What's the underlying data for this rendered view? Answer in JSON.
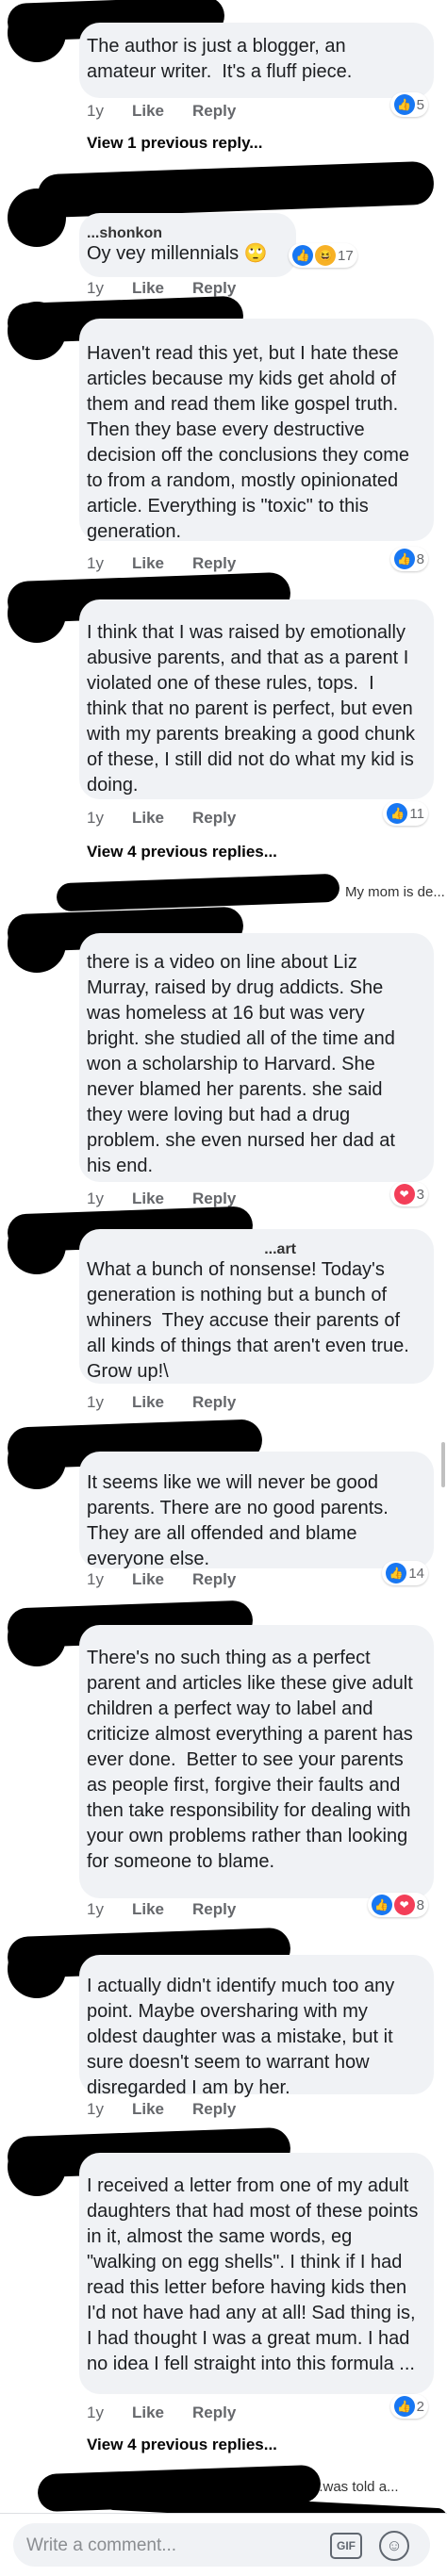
{
  "comments": [
    {
      "author": "",
      "text": "The author is just a blogger, an amateur writer.  It's a fluff piece.",
      "time": "1y",
      "like": "Like",
      "reply": "Reply",
      "reactions": "5",
      "view_replies": "View 1 previous reply..."
    },
    {
      "author": "...shonkon",
      "text": "Oy vey millennials 🙄",
      "time": "1y",
      "like": "Like",
      "reply": "Reply",
      "reactions": "17"
    },
    {
      "author": "",
      "text": "Haven't read this yet, but I hate these articles because my kids get ahold of them and read them like gospel truth. Then they base every destructive decision off the conclusions they come to from a random, mostly opinionated article. Everything is \"toxic\" to this generation.",
      "time": "1y",
      "like": "Like",
      "reply": "Reply",
      "reactions": "8"
    },
    {
      "author": "",
      "text": "I think that I was raised by emotionally abusive parents, and that as a parent I violated one of these rules, tops.  I think that no parent is perfect, but even with my parents breaking a good chunk of these, I still did not do what my kid is doing.",
      "time": "1y",
      "like": "Like",
      "reply": "Reply",
      "reactions": "11",
      "view_replies": "View 4 previous replies..."
    },
    {
      "author": "",
      "text": "there is a video on line about Liz Murray, raised by drug addicts. She was homeless at 16 but was very bright. she studied all of the time and won a scholarship to Harvard. She never blamed her parents. she said they were loving but had a drug problem. she even nursed her dad at his end.",
      "time": "1y",
      "like": "Like",
      "reply": "Reply",
      "reactions": "3"
    },
    {
      "author": "...art",
      "text": "What a bunch of nonsense! Today's generation is nothing but a bunch of whiners  They accuse their parents of all kinds of things that aren't even true. Grow up!\\",
      "time": "1y",
      "like": "Like",
      "reply": "Reply",
      "reactions": ""
    },
    {
      "author": "",
      "text": "It seems like we will never be good parents. There are no good parents. They are all offended and blame everyone else.",
      "time": "1y",
      "like": "Like",
      "reply": "Reply",
      "reactions": "14"
    },
    {
      "author": "",
      "text": "There's no such thing as a perfect parent and articles like these give adult children a perfect way to label and criticize almost everything a parent has ever done.  Better to see your parents as people first, forgive their faults and then take responsibility for dealing with your own problems rather than looking for someone to blame.",
      "time": "1y",
      "like": "Like",
      "reply": "Reply",
      "reactions": "8"
    },
    {
      "author": "",
      "text": "I actually didn't identify much too any point. Maybe oversharing with my oldest daughter was a mistake, but it sure doesn't seem to warrant how disregarded I am by her.",
      "time": "1y",
      "like": "Like",
      "reply": "Reply",
      "reactions": ""
    },
    {
      "author": "",
      "text": "I received a letter from one of my adult daughters that had most of these points in it, almost the same words, eg \"walking on egg shells\". I think if I had read this letter before having kids then I'd not have had any at all! Sad thing is, I had thought I was a great mum. I had no idea I fell straight into this formula ...",
      "time": "1y",
      "like": "Like",
      "reply": "Reply",
      "reactions": "2",
      "view_replies": "View 4 previous replies..."
    }
  ],
  "reply_previews": [
    {
      "text": "My mom is de..."
    },
    {
      "text": "...was told a..."
    }
  ],
  "composer": {
    "placeholder": "Write a comment...",
    "gif_label": "GIF"
  },
  "colors": {
    "like": "#1877f2",
    "love": "#f33e58",
    "haha": "#f7b125",
    "bubble": "#f0f2f5"
  }
}
